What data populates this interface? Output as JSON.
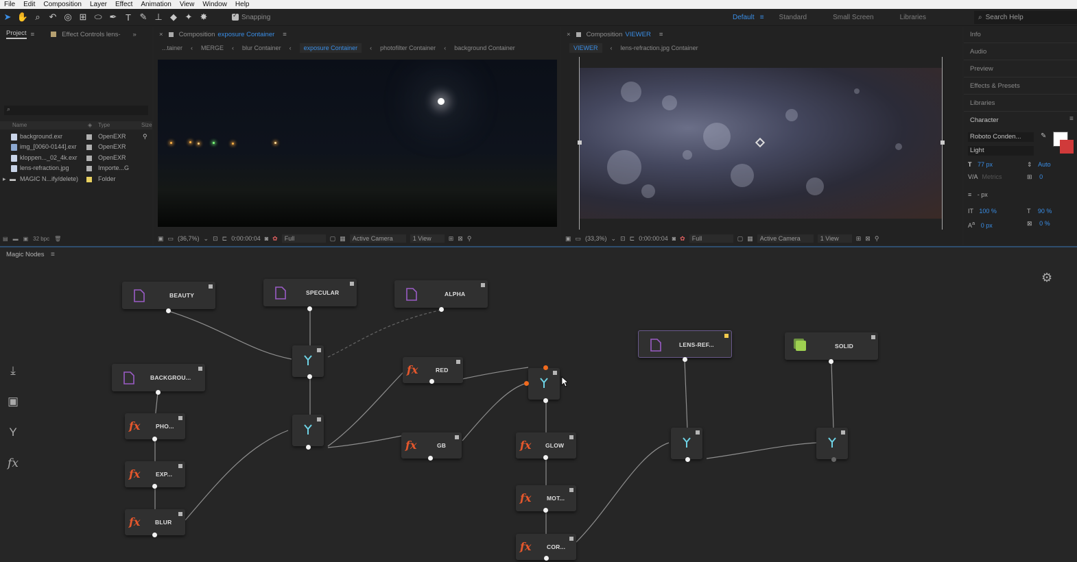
{
  "menu": [
    "File",
    "Edit",
    "Composition",
    "Layer",
    "Effect",
    "Animation",
    "View",
    "Window",
    "Help"
  ],
  "toolbar": {
    "snapping_label": "Snapping",
    "workspaces": [
      "Default",
      "Standard",
      "Small Screen",
      "Libraries"
    ],
    "search_placeholder": "Search Help"
  },
  "project": {
    "tab": "Project",
    "tab2": "Effect Controls lens-",
    "columns": [
      "Name",
      "Type",
      "Size"
    ],
    "items": [
      {
        "name": "background.exr",
        "type": "OpenEXR",
        "label_color": "#b0b0b0"
      },
      {
        "name": "img_[0060-0144].exr",
        "type": "OpenEXR",
        "label_color": "#b0b0b0"
      },
      {
        "name": "kloppen..._02_4k.exr",
        "type": "OpenEXR",
        "label_color": "#b0b0b0"
      },
      {
        "name": "lens-refraction.jpg",
        "type": "Importe...G",
        "label_color": "#b0b0b0"
      },
      {
        "name": "MAGIC N...ify/delete)",
        "type": "Folder",
        "label_color": "#e8d060"
      }
    ],
    "bpc": "32 bpc"
  },
  "comp1": {
    "title_prefix": "Composition",
    "title_name": "exposure Container",
    "crumbs": [
      "...tainer",
      "MERGE",
      "blur Container",
      "exposure Container",
      "photofilter Container",
      "background Container"
    ],
    "active_crumb": "exposure Container",
    "zoom": "(36,7%)",
    "time": "0:00:00:04",
    "resolution": "Full",
    "camera": "Active Camera",
    "views": "1 View"
  },
  "comp2": {
    "title_prefix": "Composition",
    "title_name": "VIEWER",
    "crumb_active": "VIEWER",
    "crumb_rest": "lens-refraction.jpg  Container",
    "zoom": "(33,3%)",
    "time": "0:00:00:04",
    "resolution": "Full",
    "camera": "Active Camera",
    "views": "1 View"
  },
  "right_panel": {
    "items": [
      "Info",
      "Audio",
      "Preview",
      "Effects & Presets",
      "Libraries",
      "Character"
    ],
    "font": "Roboto Conden...",
    "style": "Light",
    "size": "77 px",
    "leading": "Auto",
    "kerning": "Metrics",
    "tracking": "0",
    "stroke": "- px",
    "vscale": "100 %",
    "hscale": "90 %",
    "baseline": "0 px",
    "tsume": "0 %"
  },
  "magic_nodes": {
    "title": "Magic Nodes",
    "nodes": {
      "beauty": "BEAUTY",
      "specular": "SPECULAR",
      "alpha": "ALPHA",
      "background": "BACKGROU...",
      "pho": "PHO...",
      "exp": "EXP...",
      "blur": "BLUR",
      "red": "RED",
      "gb": "GB",
      "glow": "GLOW",
      "mot": "MOT...",
      "cor": "COR...",
      "lens": "LENS-REF...",
      "solid": "SOLID"
    }
  },
  "colors": {
    "accent": "#3a8ee6",
    "fx": "#e5572c",
    "merge_icon": "#6ed3e6",
    "node_doc": "#9a5cc6"
  }
}
